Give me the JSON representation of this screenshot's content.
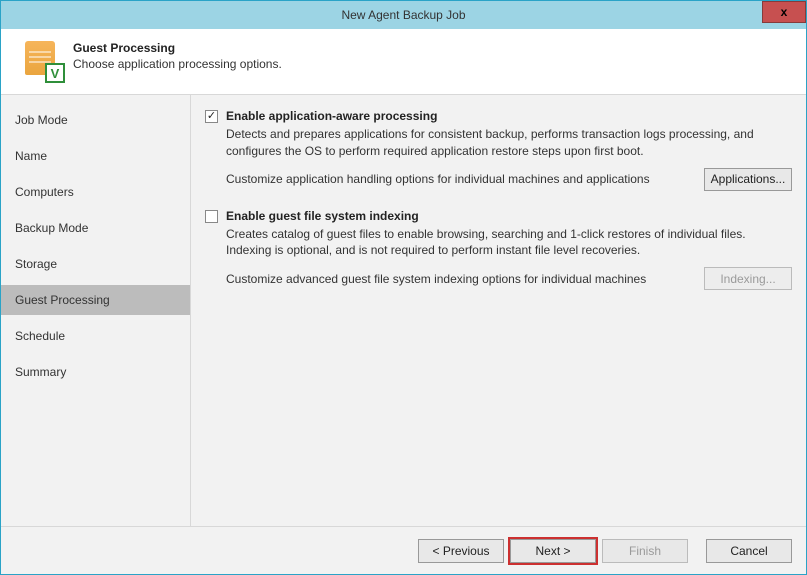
{
  "window": {
    "title": "New Agent Backup Job",
    "close": "x"
  },
  "header": {
    "title": "Guest Processing",
    "subtitle": "Choose application processing options.",
    "badge": "V"
  },
  "sidebar": {
    "items": [
      {
        "label": "Job Mode"
      },
      {
        "label": "Name"
      },
      {
        "label": "Computers"
      },
      {
        "label": "Backup Mode"
      },
      {
        "label": "Storage"
      },
      {
        "label": "Guest Processing"
      },
      {
        "label": "Schedule"
      },
      {
        "label": "Summary"
      }
    ],
    "active_index": 5
  },
  "sections": {
    "app_aware": {
      "checked": true,
      "label": "Enable application-aware processing",
      "desc": "Detects and prepares applications for consistent backup, performs transaction logs processing, and configures the OS to perform required application restore steps upon first boot.",
      "customize_text": "Customize application handling options for individual machines and applications",
      "button": "Applications..."
    },
    "indexing": {
      "checked": false,
      "label": "Enable guest file system indexing",
      "desc": "Creates catalog of guest files to enable browsing, searching and 1-click restores of individual files. Indexing is optional, and is not required to perform instant file level recoveries.",
      "customize_text": "Customize advanced guest file system indexing options for individual machines",
      "button": "Indexing..."
    }
  },
  "footer": {
    "previous": "< Previous",
    "next": "Next >",
    "finish": "Finish",
    "cancel": "Cancel"
  }
}
